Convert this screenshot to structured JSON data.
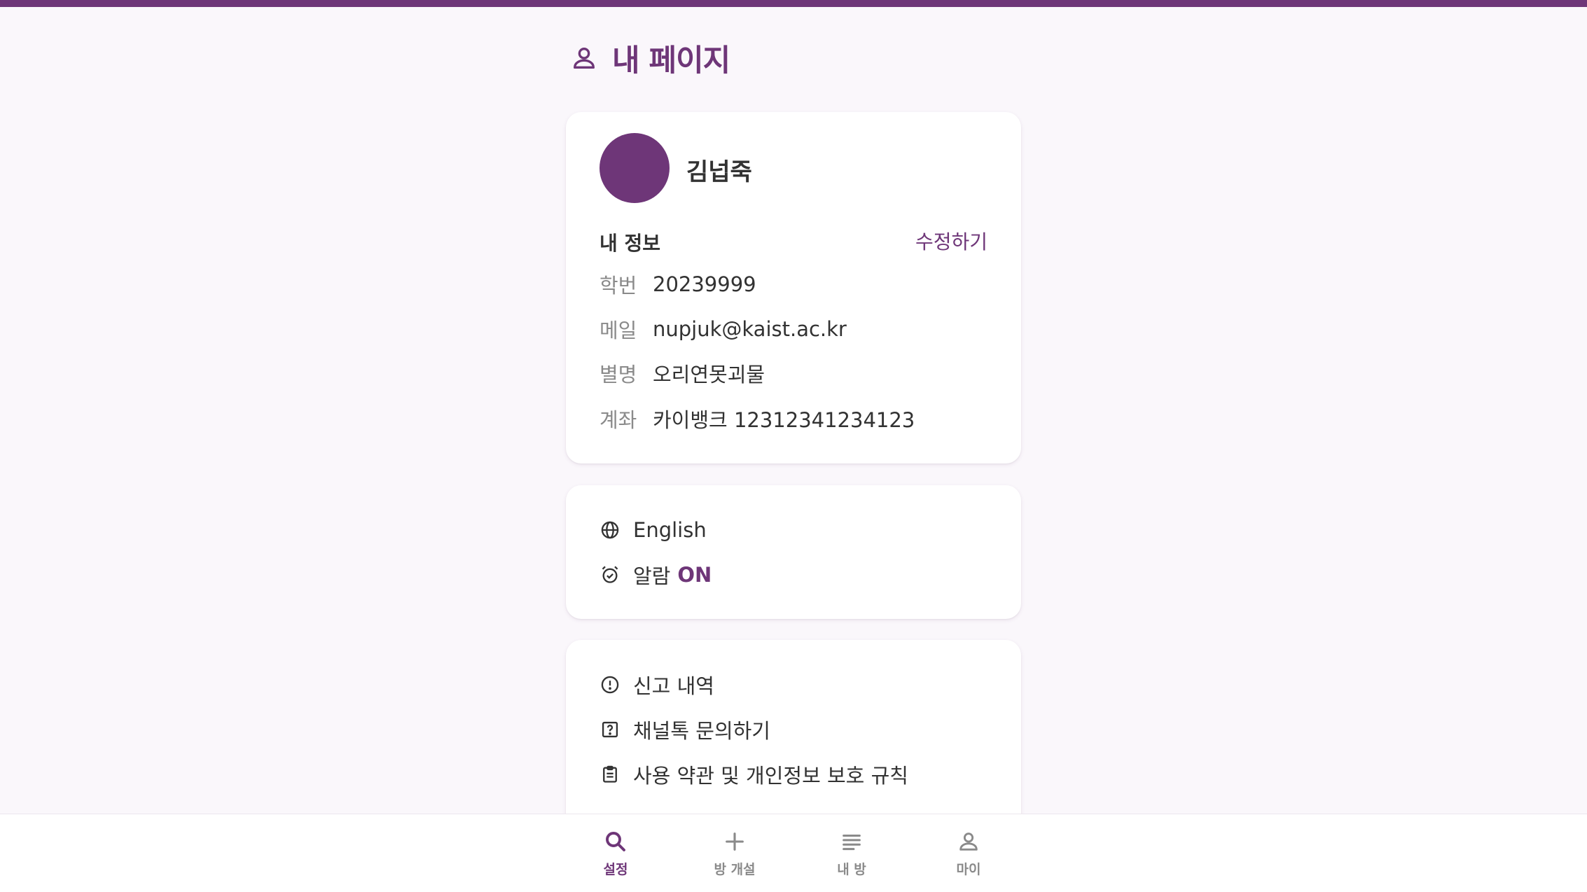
{
  "page": {
    "title": "내 페이지"
  },
  "profile": {
    "name": "김넙죽",
    "section_title": "내 정보",
    "edit_label": "수정하기",
    "fields": [
      {
        "label": "학번",
        "value": "20239999"
      },
      {
        "label": "메일",
        "value": "nupjuk@kaist.ac.kr"
      },
      {
        "label": "별명",
        "value": "오리연못괴물"
      },
      {
        "label": "계좌",
        "value": "카이뱅크 12312341234123"
      }
    ]
  },
  "settings": {
    "language": {
      "icon": "globe-icon",
      "label": "English"
    },
    "alarm": {
      "icon": "alarm-icon",
      "label": "알람",
      "status": "ON"
    }
  },
  "links": [
    {
      "icon": "alert-circle-icon",
      "label": "신고 내역"
    },
    {
      "icon": "question-box-icon",
      "label": "채널톡 문의하기"
    },
    {
      "icon": "clipboard-icon",
      "label": "사용 약관 및 개인정보 보호 규칙"
    }
  ],
  "nav": [
    {
      "icon": "search-icon",
      "label": "설정",
      "active": true
    },
    {
      "icon": "plus-icon",
      "label": "방 개설",
      "active": false
    },
    {
      "icon": "list-icon",
      "label": "내 방",
      "active": false
    },
    {
      "icon": "person-icon",
      "label": "마이",
      "active": false
    }
  ],
  "colors": {
    "accent": "#6e3678",
    "background": "#faf7fb",
    "text": "#323232",
    "muted": "#8a8a8a"
  }
}
